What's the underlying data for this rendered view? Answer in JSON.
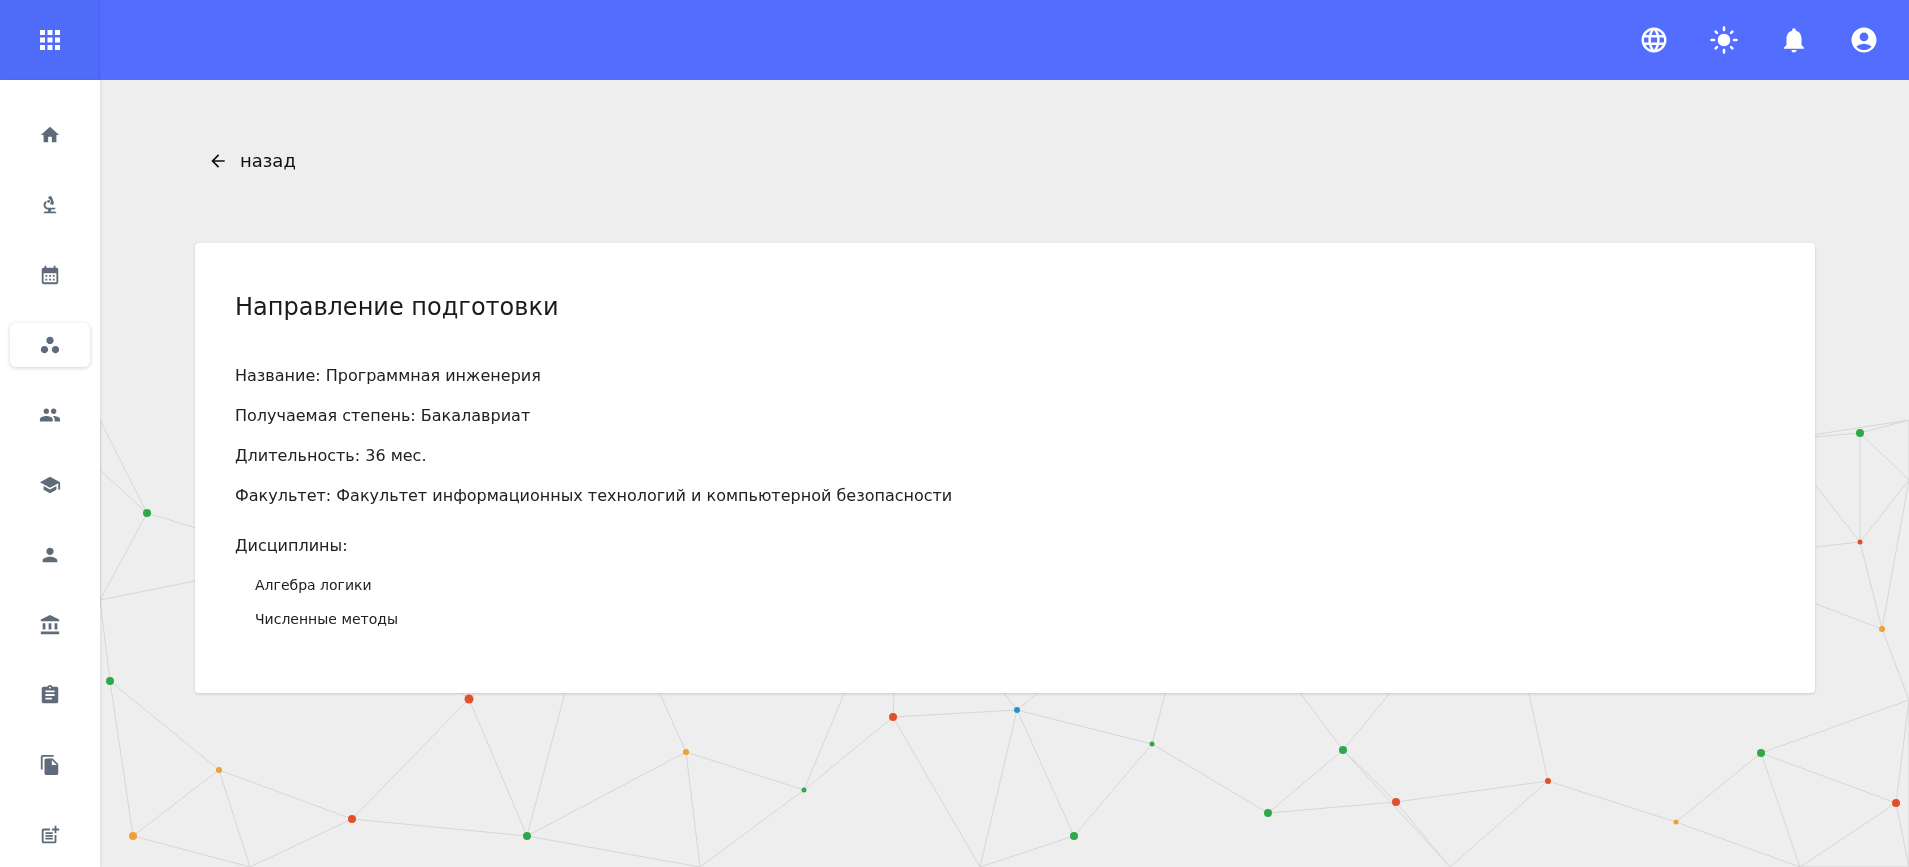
{
  "sidebar": {
    "items": [
      {
        "selected": false
      },
      {
        "selected": false
      },
      {
        "selected": false
      },
      {
        "selected": true
      },
      {
        "selected": false
      },
      {
        "selected": false
      },
      {
        "selected": false
      },
      {
        "selected": false
      },
      {
        "selected": false
      },
      {
        "selected": false
      },
      {
        "selected": false
      }
    ]
  },
  "back_link": {
    "label": "назад"
  },
  "card": {
    "title": "Направление подготовки",
    "fields": [
      "Название: Программная инженерия",
      "Получаемая степень: Бакалавриат",
      "Длительность: 36 мес.",
      "Факультет: Факультет информационных технологий и компьютерной безопасности"
    ],
    "disciplines_label": "Дисциплины:",
    "disciplines": [
      "Алгебра логики",
      "Численные методы"
    ]
  }
}
